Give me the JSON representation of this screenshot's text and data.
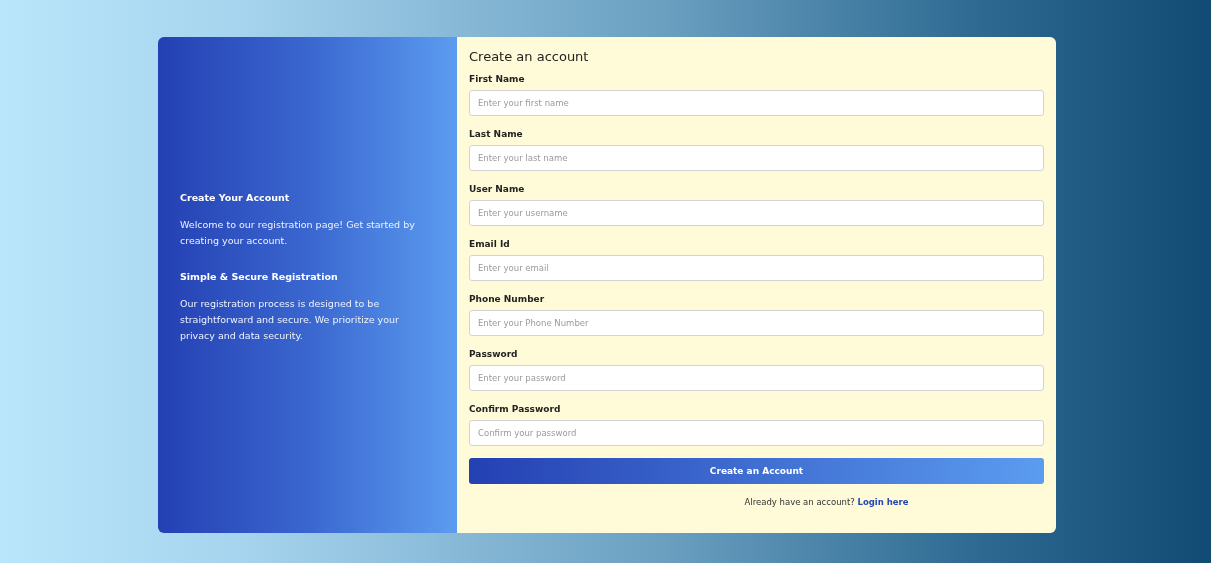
{
  "info_panel": {
    "sections": [
      {
        "heading": "Create Your Account",
        "text": "Welcome to our registration page! Get started by creating your account."
      },
      {
        "heading": "Simple & Secure Registration",
        "text": "Our registration process is designed to be straightforward and secure. We prioritize your privacy and data security."
      }
    ]
  },
  "form": {
    "title": "Create an account",
    "fields": [
      {
        "label": "First Name",
        "placeholder": "Enter your first name"
      },
      {
        "label": "Last Name",
        "placeholder": "Enter your last name"
      },
      {
        "label": "User Name",
        "placeholder": "Enter your username"
      },
      {
        "label": "Email Id",
        "placeholder": "Enter your email"
      },
      {
        "label": "Phone Number",
        "placeholder": "Enter your Phone Number"
      },
      {
        "label": "Password",
        "placeholder": "Enter your password"
      },
      {
        "label": "Confirm Password",
        "placeholder": "Confirm your password"
      }
    ],
    "submit": "Create an Account",
    "login_prompt": "Already have an account?",
    "login_link": "Login here"
  }
}
